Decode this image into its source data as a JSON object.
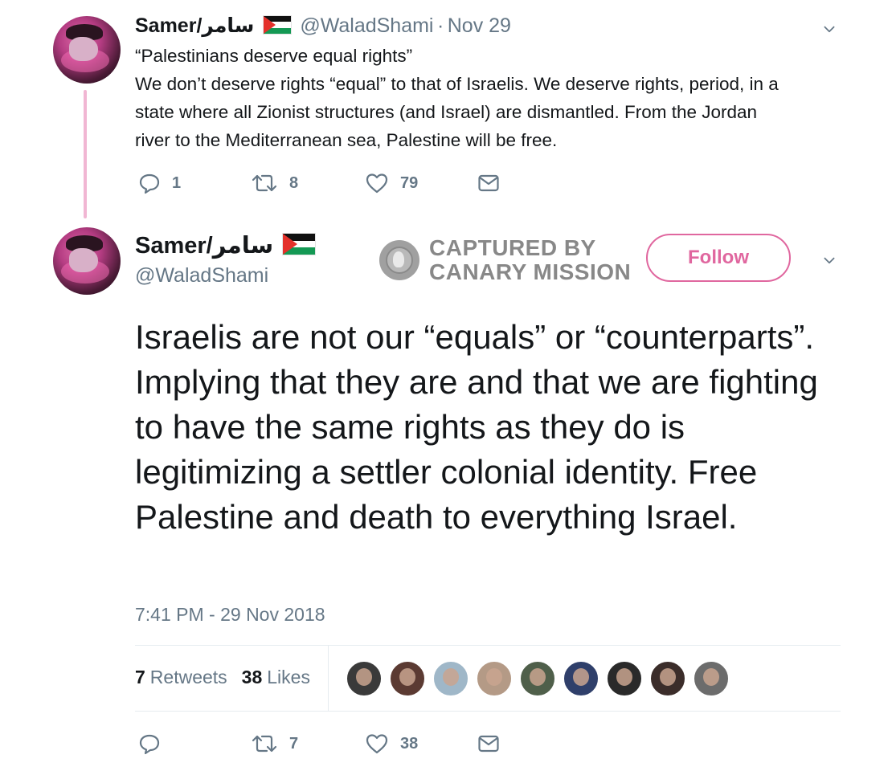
{
  "tweet1": {
    "name": "Samer/سامر",
    "handle": "@WaladShami",
    "separator": "·",
    "date": "Nov 29",
    "lines": [
      "“Palestinians deserve equal rights”",
      "We don’t deserve rights “equal” to that of Israelis. We deserve rights, period, in a",
      "state where all Zionist structures (and Israel) are dismantled. From the Jordan",
      "river to the Mediterranean sea, Palestine will be free."
    ],
    "actions": {
      "replies": "1",
      "retweets": "8",
      "likes": "79"
    }
  },
  "tweet2": {
    "name": "Samer/سامر",
    "handle": "@WaladShami",
    "follow_label": "Follow",
    "text": "Israelis are not our “equals” or “counterparts”. Implying that they are and that we are fighting to have the same rights as they do is legitimizing a settler colonial identity. Free Palestine and death to everything Israel.",
    "timestamp": "7:41 PM - 29 Nov 2018",
    "stats": {
      "retweets_count": "7",
      "retweets_label": "Retweets",
      "likes_count": "38",
      "likes_label": "Likes"
    },
    "actions": {
      "retweets": "7",
      "likes": "38"
    },
    "liker_colors": [
      "#3a3a3a",
      "#5b3a32",
      "#9fb7c8",
      "#b49a86",
      "#4f5f4a",
      "#2f3f6a",
      "#2a2a2a",
      "#3b2d2a",
      "#6c6c6c"
    ]
  },
  "watermark": {
    "line1": "CAPTURED BY",
    "line2": "CANARY MISSION"
  },
  "colors": {
    "accent_pink": "#e0679f",
    "thread_line": "#f1b6d3",
    "muted": "#657786"
  }
}
